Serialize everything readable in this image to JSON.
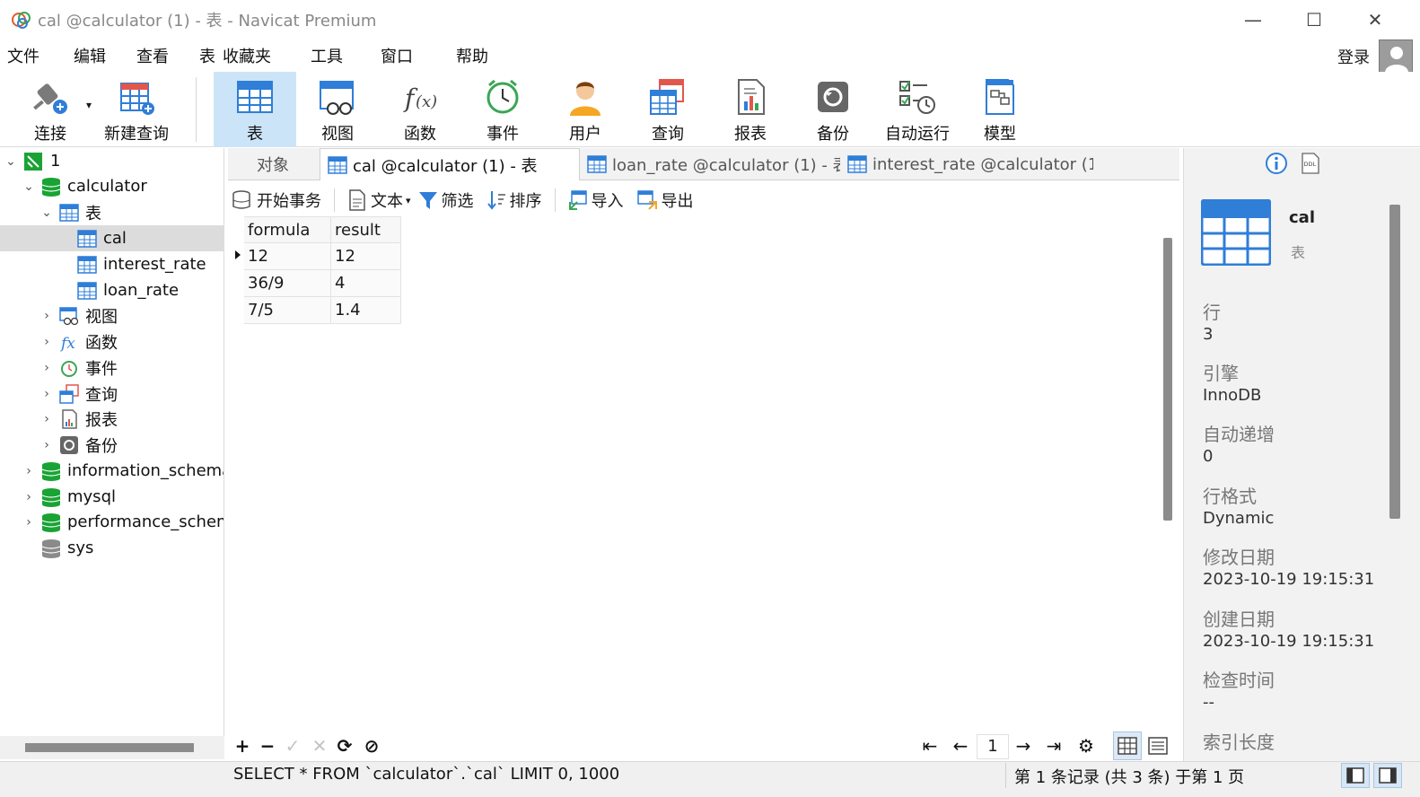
{
  "window": {
    "title": "cal @calculator (1) - 表 - Navicat Premium",
    "controls": {
      "minimize": "—",
      "maximize": "☐",
      "close": "✕"
    }
  },
  "menu": [
    "文件",
    "编辑",
    "查看",
    "表",
    "收藏夹",
    "工具",
    "窗口",
    "帮助"
  ],
  "account": {
    "login_label": "登录"
  },
  "toolbar": {
    "buttons": [
      {
        "label": "连接",
        "icon": "plug-connect-icon"
      },
      {
        "label": "新建查询",
        "icon": "new-query-icon"
      },
      {
        "label": "表",
        "icon": "table-icon",
        "active": true
      },
      {
        "label": "视图",
        "icon": "view-icon"
      },
      {
        "label": "函数",
        "icon": "function-icon"
      },
      {
        "label": "事件",
        "icon": "clock-event-icon"
      },
      {
        "label": "用户",
        "icon": "user-icon"
      },
      {
        "label": "查询",
        "icon": "query-icon"
      },
      {
        "label": "报表",
        "icon": "report-icon"
      },
      {
        "label": "备份",
        "icon": "backup-icon"
      },
      {
        "label": "自动运行",
        "icon": "automation-icon"
      },
      {
        "label": "模型",
        "icon": "model-icon"
      }
    ]
  },
  "tree": {
    "connection": "1",
    "database": "calculator",
    "tables_group": "表",
    "tables": [
      "cal",
      "interest_rate",
      "loan_rate"
    ],
    "selected_table": "cal",
    "groups": [
      "视图",
      "函数",
      "事件",
      "查询",
      "报表",
      "备份"
    ],
    "other_databases": [
      "information_schema",
      "mysql",
      "performance_schema",
      "sys"
    ]
  },
  "tabs": [
    {
      "label": "对象"
    },
    {
      "label": "cal @calculator (1) - 表",
      "active": true
    },
    {
      "label": "loan_rate @calculator (1) - 表"
    },
    {
      "label": "interest_rate @calculator (1..."
    }
  ],
  "inner_toolbar": {
    "begin_transaction": "开始事务",
    "text": "文本",
    "filter": "筛选",
    "sort": "排序",
    "import": "导入",
    "export": "导出"
  },
  "grid": {
    "columns": [
      "formula",
      "result"
    ],
    "rows": [
      [
        "12",
        "12"
      ],
      [
        "36/9",
        "4"
      ],
      [
        "7/5",
        "1.4"
      ]
    ]
  },
  "grid_bar": {
    "add": "+",
    "delete": "−",
    "apply": "✓",
    "discard": "✕",
    "refresh": "⟳",
    "stop": "⊘",
    "first": "⇤",
    "prev": "←",
    "page": "1",
    "next": "→",
    "last": "⇥",
    "settings": "⚙"
  },
  "status": {
    "sql": "SELECT * FROM `calculator`.`cal` LIMIT 0, 1000",
    "record_info": "第 1 条记录 (共 3 条) 于第 1 页"
  },
  "info_panel": {
    "object_name": "cal",
    "object_type": "表",
    "properties": [
      {
        "label": "行",
        "value": "3"
      },
      {
        "label": "引擎",
        "value": "InnoDB"
      },
      {
        "label": "自动递增",
        "value": "0"
      },
      {
        "label": "行格式",
        "value": "Dynamic"
      },
      {
        "label": "修改日期",
        "value": "2023-10-19 19:15:31"
      },
      {
        "label": "创建日期",
        "value": "2023-10-19 19:15:31"
      },
      {
        "label": "检查时间",
        "value": "--"
      },
      {
        "label": "索引长度",
        "value": ""
      }
    ],
    "ddl_label": "DDL"
  },
  "colors": {
    "accent": "#2f7ed8",
    "db_green": "#1aa335",
    "active_toolbar": "#cce4f7",
    "selected_row": "#dcdcdc"
  }
}
